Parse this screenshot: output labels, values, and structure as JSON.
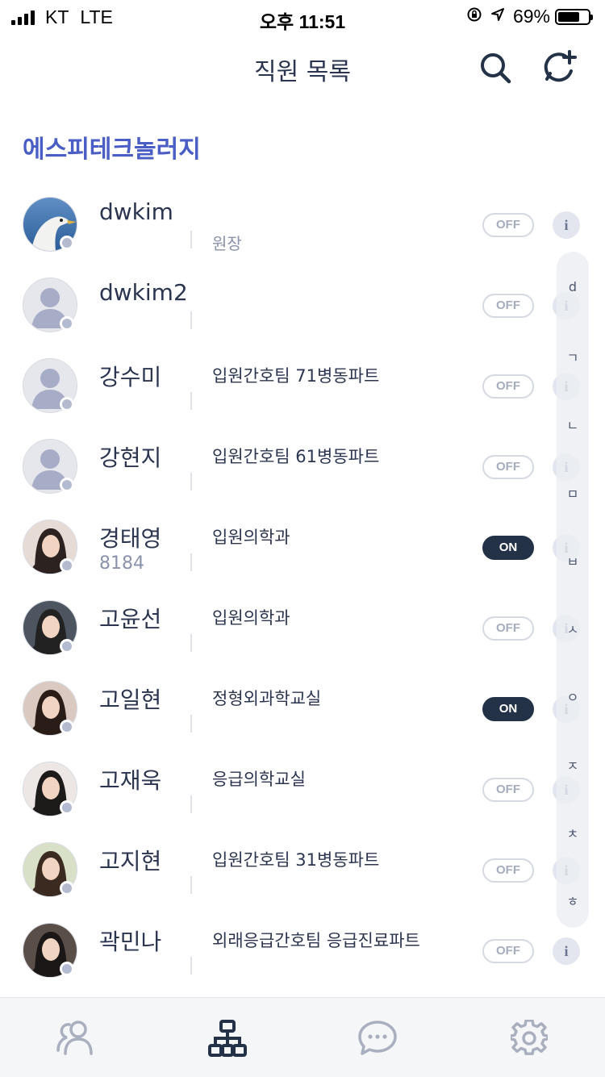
{
  "status_bar": {
    "carrier": "KT",
    "network": "LTE",
    "time": "오후 11:51",
    "battery": "69%"
  },
  "header": {
    "title": "직원 목록"
  },
  "org": {
    "name": "에스피테크놀러지"
  },
  "employees": [
    {
      "name": "dwkim",
      "ext": "",
      "dept": "",
      "rank": "원장",
      "status": "OFF",
      "avatar": "photo-bird"
    },
    {
      "name": "dwkim2",
      "ext": "",
      "dept": "",
      "rank": "",
      "status": "OFF",
      "avatar": "default"
    },
    {
      "name": "강수미",
      "ext": "",
      "dept": "입원간호팀 71병동파트",
      "rank": "",
      "status": "OFF",
      "avatar": "default"
    },
    {
      "name": "강현지",
      "ext": "",
      "dept": "입원간호팀 61병동파트",
      "rank": "",
      "status": "OFF",
      "avatar": "default"
    },
    {
      "name": "경태영",
      "ext": "8184",
      "dept": "입원의학과",
      "rank": "",
      "status": "ON",
      "avatar": "photo"
    },
    {
      "name": "고윤선",
      "ext": "",
      "dept": "입원의학과",
      "rank": "",
      "status": "OFF",
      "avatar": "photo"
    },
    {
      "name": "고일현",
      "ext": "",
      "dept": "정형외과학교실",
      "rank": "",
      "status": "ON",
      "avatar": "photo"
    },
    {
      "name": "고재욱",
      "ext": "",
      "dept": "응급의학교실",
      "rank": "",
      "status": "OFF",
      "avatar": "photo"
    },
    {
      "name": "고지현",
      "ext": "",
      "dept": "입원간호팀 31병동파트",
      "rank": "",
      "status": "OFF",
      "avatar": "photo"
    },
    {
      "name": "곽민나",
      "ext": "",
      "dept": "외래응급간호팀 응급진료파트",
      "rank": "",
      "status": "OFF",
      "avatar": "photo"
    }
  ],
  "info_label": "i",
  "index_letters": [
    "d",
    "ㄱ",
    "ㄴ",
    "ㅁ",
    "ㅂ",
    "ㅅ",
    "ㅇ",
    "ㅈ",
    "ㅊ",
    "ㅎ"
  ],
  "tabs": [
    {
      "icon": "people-icon",
      "active": false
    },
    {
      "icon": "org-chart-icon",
      "active": true
    },
    {
      "icon": "chat-icon",
      "active": false
    },
    {
      "icon": "gear-icon",
      "active": false
    }
  ],
  "colors": {
    "accent": "#4a5ec5",
    "text": "#2b3550",
    "toggle_on": "#243247",
    "active_tab": "#243247",
    "inactive_tab": "#a9afbf"
  }
}
